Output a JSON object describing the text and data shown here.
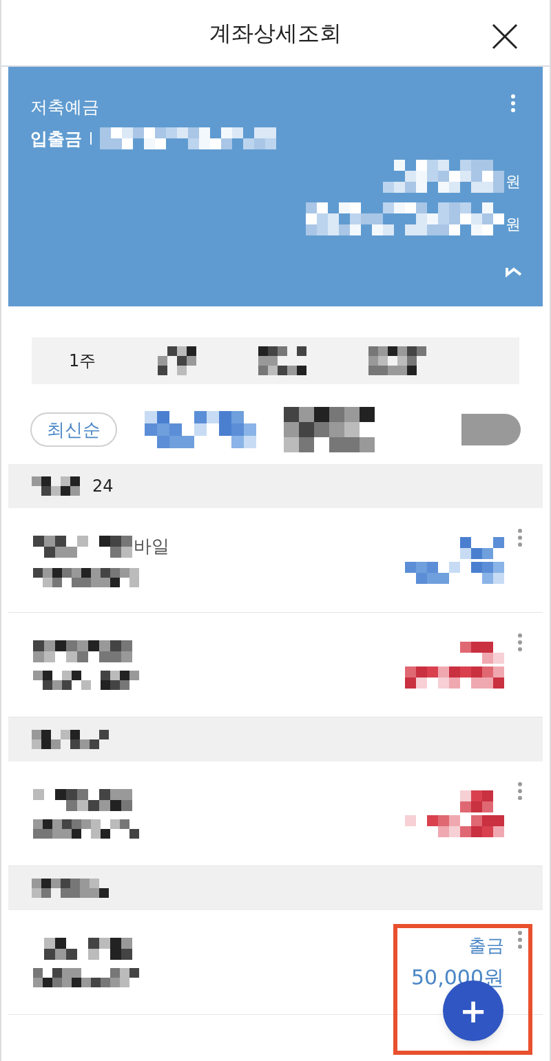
{
  "header": {
    "title": "계좌상세조회"
  },
  "account_card": {
    "product": "저축예금",
    "account_type": "입출금",
    "balances": [
      {
        "unit": "원"
      },
      {
        "unit": "원"
      }
    ]
  },
  "period_filter": {
    "label": "1주"
  },
  "sort": {
    "label": "최신순"
  },
  "groups": [
    {
      "date": "24",
      "transactions": [
        {
          "name": "바일",
          "kind": "withdrawal"
        },
        {
          "kind": "deposit"
        }
      ]
    },
    {
      "transactions": [
        {
          "kind": "deposit"
        }
      ]
    },
    {
      "transactions": [
        {
          "type": "출금",
          "amount": "50,000원",
          "kind": "withdrawal"
        }
      ]
    }
  ],
  "fab": {
    "label": "+"
  }
}
